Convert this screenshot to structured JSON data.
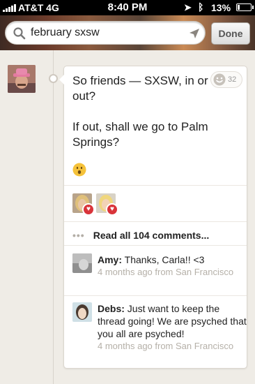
{
  "status_bar": {
    "carrier": "AT&T  4G",
    "time": "8:40 PM",
    "battery": "13%"
  },
  "search": {
    "query": "february sxsw",
    "done_label": "Done"
  },
  "post": {
    "line1": "So friends — SXSW, in or out?",
    "line2": "If out, shall we go to Palm Springs?",
    "emoji": "😮",
    "like_count": "32"
  },
  "likers": [
    {
      "name": "liker-1"
    },
    {
      "name": "liker-2"
    }
  ],
  "read_more": {
    "dots": "•••",
    "label": "Read all 104 comments..."
  },
  "comments": [
    {
      "author": "Amy:",
      "text": "Thanks, Carla!! <3",
      "meta": "4 months ago from San Francisco"
    },
    {
      "author": "Debs:",
      "text": "Just want to keep the thread going! We are psyched that you all are psyched!",
      "meta": "4 months ago from San Francisco"
    }
  ],
  "colors": {
    "heart": "#d9343a",
    "divider": "#ebe7e1",
    "meta_text": "#b5b0a8"
  }
}
